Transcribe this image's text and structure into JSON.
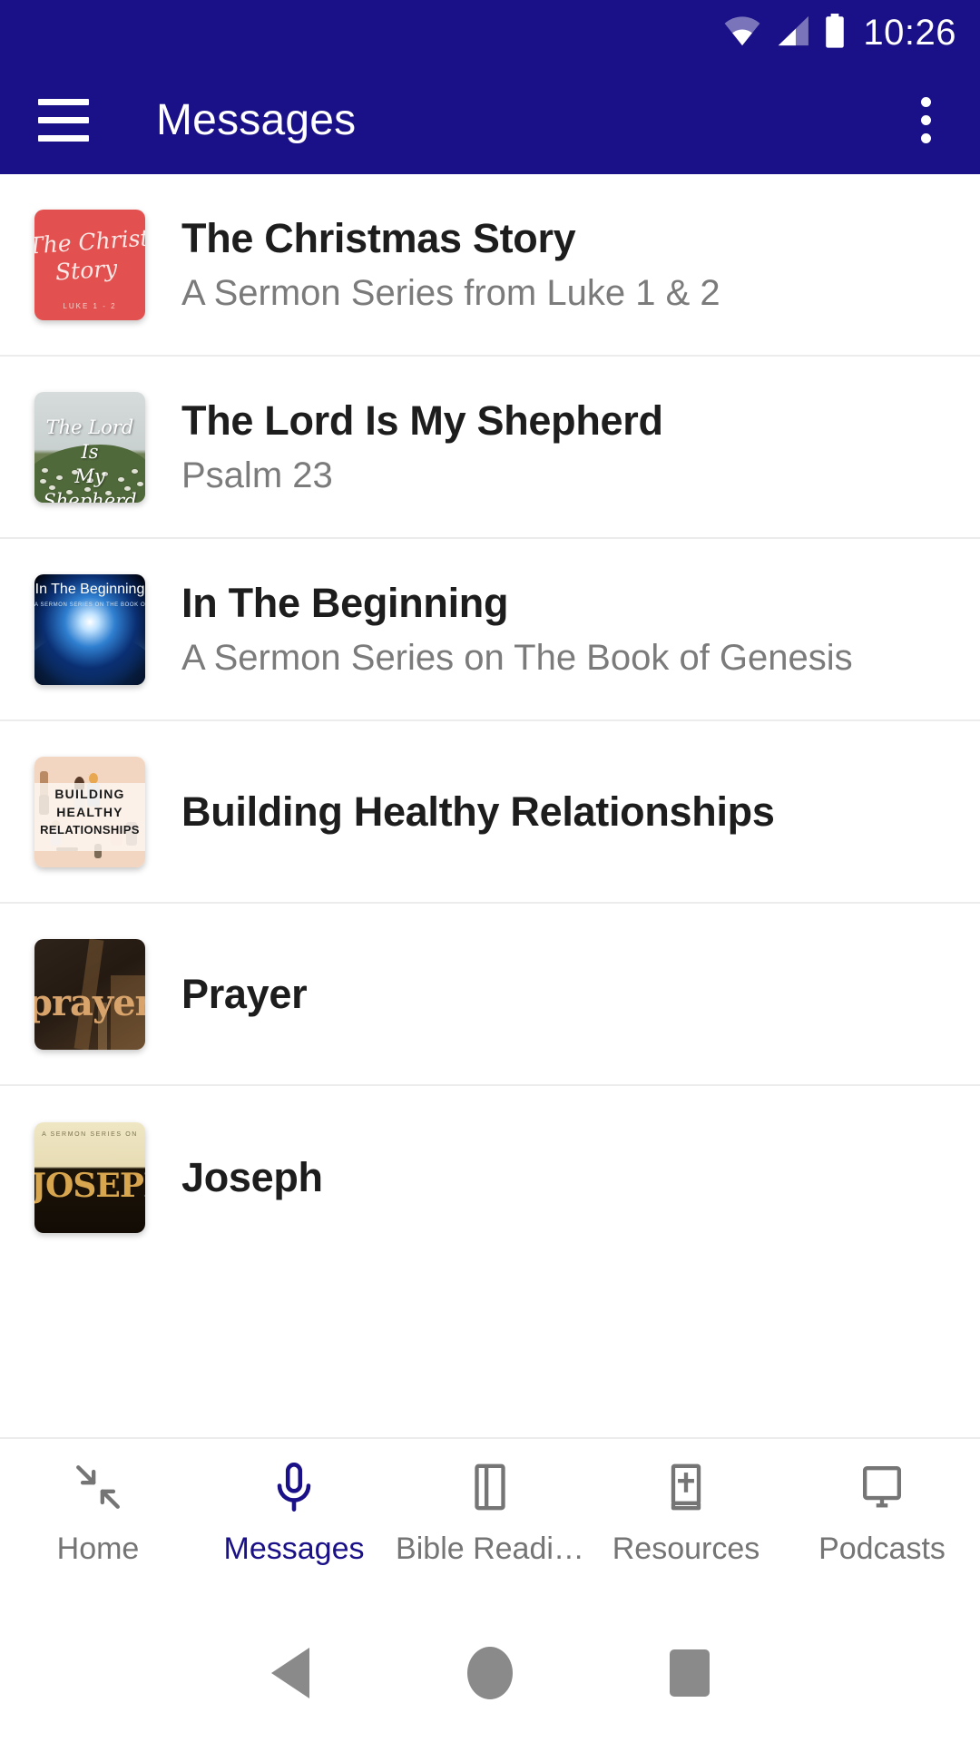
{
  "status_bar": {
    "time": "10:26",
    "icons": [
      "wifi-icon",
      "cellular-signal-icon",
      "battery-icon"
    ]
  },
  "app_bar": {
    "menu_icon": "hamburger-menu-icon",
    "title": "Messages",
    "overflow_icon": "more-vertical-icon",
    "background_color": "#1a1088"
  },
  "messages": [
    {
      "title": "The Christmas Story",
      "subtitle": "A Sermon Series from Luke 1 & 2",
      "thumbnail": {
        "name": "the-christmas-story-artwork",
        "line1": "The Christmas",
        "line2": "Story",
        "caption": "LUKE 1 - 2",
        "color": "#e2504f"
      }
    },
    {
      "title": "The Lord Is My Shepherd",
      "subtitle": "Psalm 23",
      "thumbnail": {
        "name": "the-lord-is-my-shepherd-artwork",
        "line1": "The Lord Is",
        "line2": "My Shepherd",
        "color": "#50693a"
      }
    },
    {
      "title": "In The Beginning",
      "subtitle": "A Sermon Series on The Book of Genesis",
      "thumbnail": {
        "name": "in-the-beginning-artwork",
        "line1": "In The Beginning",
        "caption": "A SERMON SERIES ON THE BOOK OF GENESIS",
        "color": "#01030c"
      }
    },
    {
      "title": "Building Healthy Relationships",
      "subtitle": "",
      "thumbnail": {
        "name": "building-healthy-relationships-artwork",
        "line1": "BUILDING",
        "line2": "HEALTHY",
        "line3": "RELATIONSHIPS",
        "color": "#f3d6c2"
      }
    },
    {
      "title": "Prayer",
      "subtitle": "",
      "thumbnail": {
        "name": "prayer-artwork",
        "line1": "prayer",
        "color": "#2e231a"
      }
    },
    {
      "title": "Joseph",
      "subtitle": "",
      "thumbnail": {
        "name": "joseph-artwork",
        "caption": "A SERMON SERIES ON",
        "line1": "JOSEPH",
        "color": "#d8a64f"
      }
    }
  ],
  "bottom_nav": {
    "active_color": "#1a1088",
    "inactive_color": "#757575",
    "tabs": [
      {
        "label": "Home",
        "icon": "arrows-inward-icon",
        "active": false
      },
      {
        "label": "Messages",
        "icon": "microphone-icon",
        "active": true
      },
      {
        "label": "Bible Readi…",
        "icon": "book-flag-icon",
        "active": false
      },
      {
        "label": "Resources",
        "icon": "bible-cross-icon",
        "active": false
      },
      {
        "label": "Podcasts",
        "icon": "monitor-icon",
        "active": false
      }
    ]
  },
  "system_nav": {
    "back": "back-triangle-icon",
    "home": "home-circle-icon",
    "recents": "recents-square-icon"
  }
}
